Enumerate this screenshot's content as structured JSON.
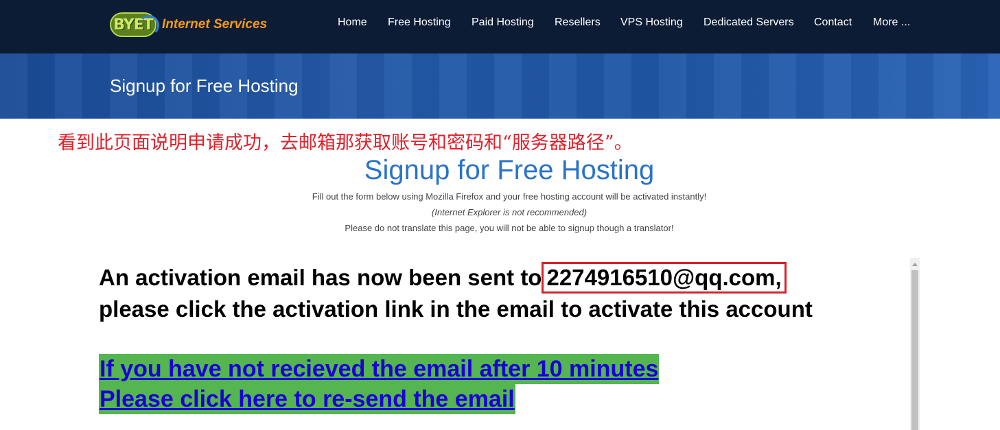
{
  "header": {
    "logo_mark": "BYET",
    "logo_text": "Internet Services",
    "nav": [
      {
        "label": "Home"
      },
      {
        "label": "Free Hosting"
      },
      {
        "label": "Paid Hosting"
      },
      {
        "label": "Resellers"
      },
      {
        "label": "VPS Hosting"
      },
      {
        "label": "Dedicated Servers"
      },
      {
        "label": "Contact"
      },
      {
        "label": "More ..."
      }
    ]
  },
  "banner": {
    "title": "Signup for Free Hosting"
  },
  "annotation": "看到此页面说明申请成功，去邮箱那获取账号和密码和“服务器路径”。",
  "form": {
    "title": "Signup for Free Hosting",
    "notes": [
      "Fill out the form below using Mozilla Firefox and your free hosting account will be activated instantly!",
      "(Internet Explorer is not recommended)",
      "Please do not translate this page, you will not be able to signup though a translator!"
    ]
  },
  "activation": {
    "prefix": "An activation email has now been sent to",
    "email": "2274916510@qq.com",
    "suffix": ",",
    "line2": "please click the activation link in the email to activate this account"
  },
  "resend": {
    "line1": "If you have not recieved the email after 10 minutes",
    "line2": "Please click here to re-send the email"
  },
  "colors": {
    "topbar": "#0d1c35",
    "banner": "#2359a8",
    "annotation_red": "#e0202a",
    "title_blue": "#2a73c8",
    "resend_bg": "#55b551",
    "link": "#1a00d6"
  }
}
